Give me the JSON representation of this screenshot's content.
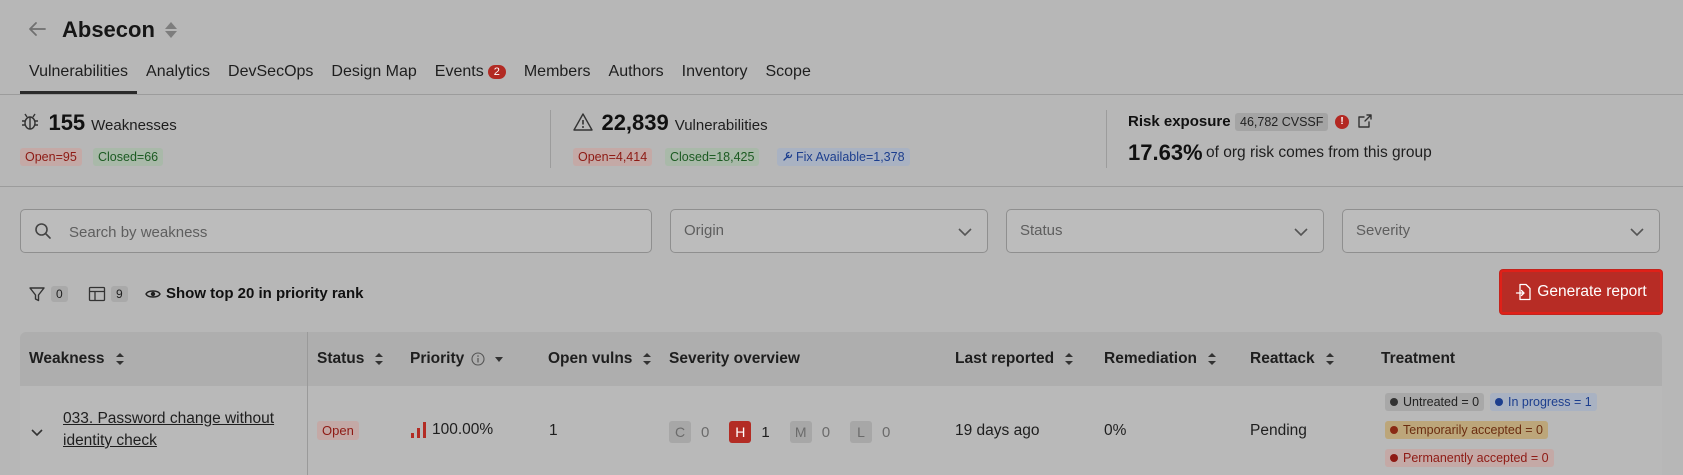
{
  "header": {
    "title": "Absecon",
    "tabs": [
      {
        "label": "Vulnerabilities",
        "active": true
      },
      {
        "label": "Analytics"
      },
      {
        "label": "DevSecOps"
      },
      {
        "label": "Design Map"
      },
      {
        "label": "Events",
        "badge": "2"
      },
      {
        "label": "Members"
      },
      {
        "label": "Authors"
      },
      {
        "label": "Inventory"
      },
      {
        "label": "Scope"
      }
    ]
  },
  "summary": {
    "weaknesses": {
      "value": "155",
      "label": "Weaknesses",
      "open": "Open=95",
      "closed": "Closed=66"
    },
    "vulnerabilities": {
      "value": "22,839",
      "label": "Vulnerabilities",
      "open": "Open=4,414",
      "closed": "Closed=18,425",
      "fix": "Fix Available=1,378"
    },
    "risk": {
      "title": "Risk exposure",
      "badge": "46,782 CVSSF",
      "alert": "!",
      "percent": "17.63%",
      "text": "of org risk comes from this group"
    }
  },
  "filters": {
    "search_placeholder": "Search by weakness",
    "origin": "Origin",
    "status": "Status",
    "severity": "Severity"
  },
  "toolbar": {
    "filter_count": "0",
    "columns_count": "9",
    "show_top": "Show top 20 in priority rank",
    "generate_report": "Generate report"
  },
  "table": {
    "headers": [
      "Weakness",
      "Status",
      "Priority",
      "Open vulns",
      "Severity overview",
      "Last reported",
      "Remediation",
      "Reattack",
      "Treatment"
    ],
    "rows": [
      {
        "weakness_line1": "033. Password change without",
        "weakness_line2": "identity check",
        "status": "Open",
        "priority": "100.00%",
        "open_vulns": "1",
        "severity": [
          {
            "letter": "C",
            "count": "0"
          },
          {
            "letter": "H",
            "count": "1"
          },
          {
            "letter": "M",
            "count": "0"
          },
          {
            "letter": "L",
            "count": "0"
          }
        ],
        "last_reported": "19 days ago",
        "remediation": "0%",
        "reattack": "Pending",
        "treatment": {
          "untreated": "Untreated = 0",
          "in_progress": "In progress = 1",
          "temporarily": "Temporarily accepted = 0",
          "permanently": "Permanently accepted = 0"
        }
      }
    ]
  },
  "colors": {
    "accent_red": "#b72c25",
    "background": "#b7b7b7"
  }
}
